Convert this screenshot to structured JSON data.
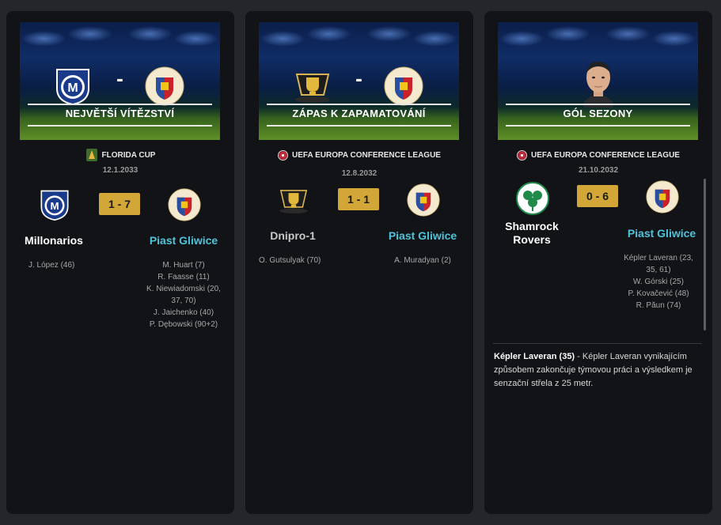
{
  "cards": [
    {
      "banner_title": "NEJVĚTŠÍ VÍTĚZSTVÍ",
      "competition": "FLORIDA CUP",
      "date": "12.1.2033",
      "home_team": "Millonarios",
      "away_team": "Piast Gliwice",
      "score": "1 - 7",
      "home_scorers": [
        "J. López (46)"
      ],
      "away_scorers": [
        "M. Huart (7)",
        "R. Faasse (11)",
        "K. Niewiadomski (20,",
        "37, 70)",
        "J. Jaichenko (40)",
        "P. Dębowski (90+2)"
      ]
    },
    {
      "banner_title": "ZÁPAS K ZAPAMATOVÁNÍ",
      "competition": "UEFA EUROPA CONFERENCE LEAGUE",
      "date": "12.8.2032",
      "home_team": "Dnipro-1",
      "away_team": "Piast Gliwice",
      "score": "1 - 1",
      "home_scorers": [
        "O. Gutsulyak (70)"
      ],
      "away_scorers": [
        "A. Muradyan (2)"
      ]
    },
    {
      "banner_title": "GÓL SEZONY",
      "competition": "UEFA EUROPA CONFERENCE LEAGUE",
      "date": "21.10.2032",
      "home_team_line1": "Shamrock",
      "home_team_line2": "Rovers",
      "away_team": "Piast Gliwice",
      "score": "0 - 6",
      "away_scorers": [
        "Képler Laveran (23,",
        "35, 61)",
        "W. Górski (25)",
        "P. Kovačević (48)",
        "R. Păun (74)"
      ],
      "goal_scorer": "Képler Laveran (35)",
      "goal_description": " - Képler Laveran vynikajícím způsobem zakončuje týmovou práci a výsledkem je senzační střela z 25 metr."
    }
  ],
  "colors": {
    "score_bg": "#d2a637",
    "away_team": "#4fc3d9",
    "card_bg": "#111317"
  },
  "icons": {
    "millonarios": "millonarios-crest-icon",
    "piast": "piast-gliwice-crest-icon",
    "dnipro": "dnipro-1-crest-icon",
    "shamrock": "shamrock-rovers-crest-icon",
    "uefa": "uefa-logo-icon",
    "florida": "florida-cup-logo-icon",
    "player": "player-face-icon"
  }
}
